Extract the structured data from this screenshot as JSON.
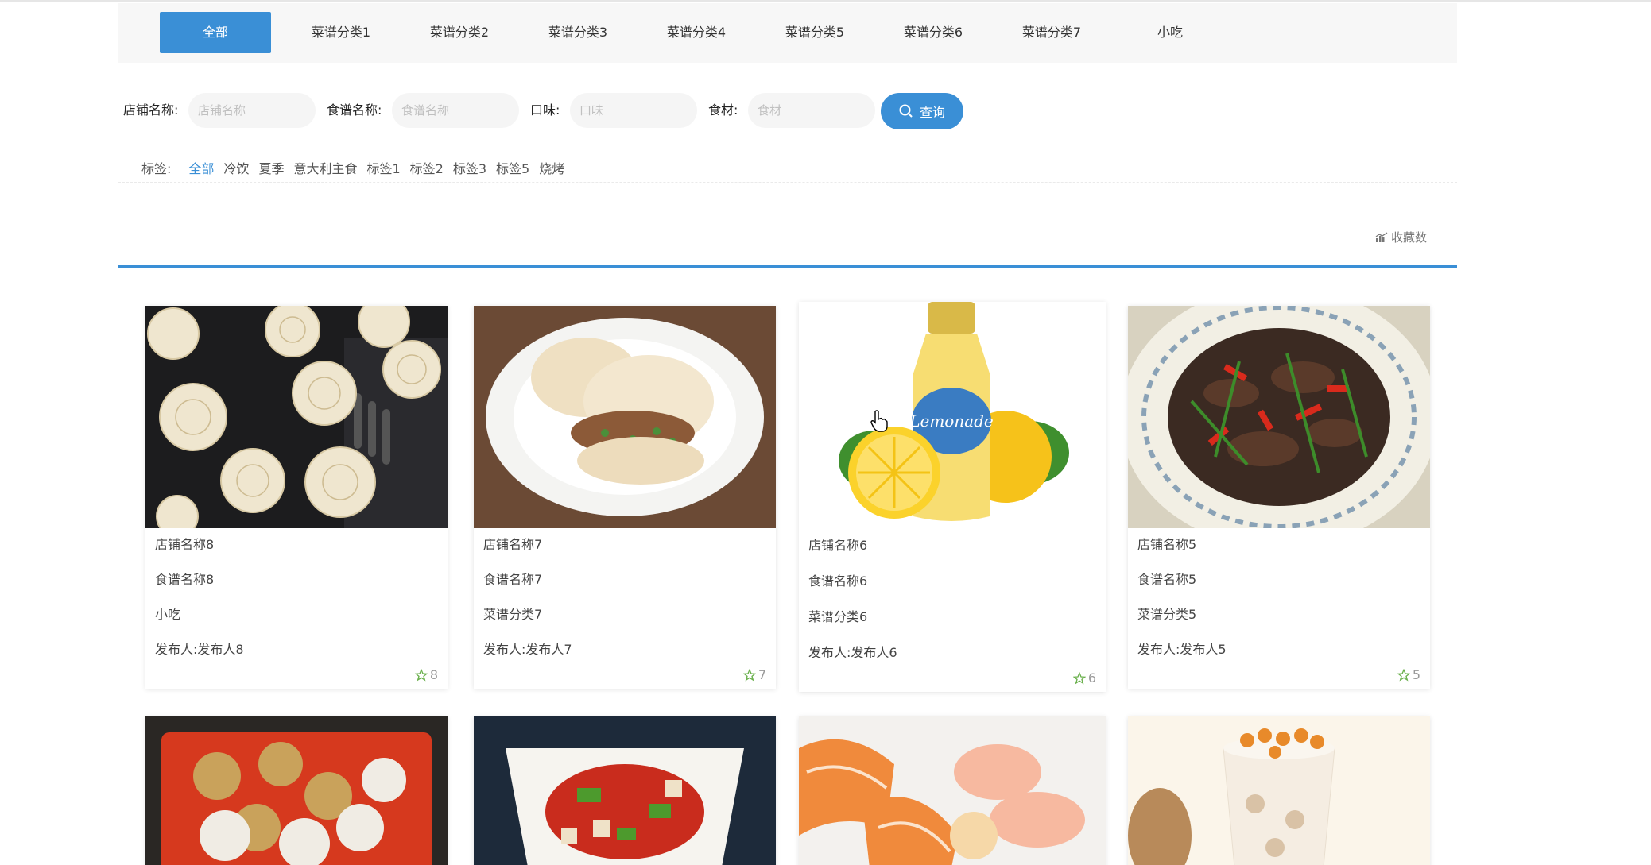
{
  "categories": [
    "全部",
    "菜谱分类1",
    "菜谱分类2",
    "菜谱分类3",
    "菜谱分类4",
    "菜谱分类5",
    "菜谱分类6",
    "菜谱分类7",
    "小吃"
  ],
  "filters": {
    "shop_label": "店铺名称:",
    "shop_placeholder": "店铺名称",
    "recipe_label": "食谱名称:",
    "recipe_placeholder": "食谱名称",
    "taste_label": "口味:",
    "taste_placeholder": "口味",
    "ingredient_label": "食材:",
    "ingredient_placeholder": "食材",
    "search_label": "查询"
  },
  "tags": {
    "label": "标签:",
    "items": [
      "全部",
      "冷饮",
      "夏季",
      "意大利主食",
      "标签1",
      "标签2",
      "标签3",
      "标签5",
      "烧烤"
    ]
  },
  "sort": {
    "favorites_label": "收藏数"
  },
  "cards": [
    {
      "shop": "店铺名称8",
      "recipe": "食谱名称8",
      "category": "小吃",
      "publisher": "发布人:发布人8",
      "favorites": "8"
    },
    {
      "shop": "店铺名称7",
      "recipe": "食谱名称7",
      "category": "菜谱分类7",
      "publisher": "发布人:发布人7",
      "favorites": "7"
    },
    {
      "shop": "店铺名称6",
      "recipe": "食谱名称6",
      "category": "菜谱分类6",
      "publisher": "发布人:发布人6",
      "favorites": "6"
    },
    {
      "shop": "店铺名称5",
      "recipe": "食谱名称5",
      "category": "菜谱分类5",
      "publisher": "发布人:发布人5",
      "favorites": "5"
    }
  ],
  "colors": {
    "accent": "#3a8fd6",
    "star": "#6ab04c"
  }
}
